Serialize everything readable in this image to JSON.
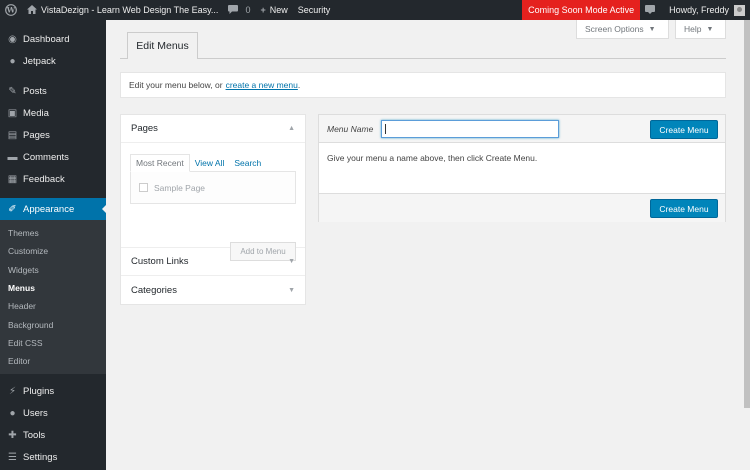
{
  "adminbar": {
    "site_name": "VistaDezign - Learn Web Design The Easy...",
    "comments_count": "0",
    "new_label": "New",
    "security_label": "Security",
    "coming_soon_label": "Coming Soon Mode Active",
    "howdy_label": "Howdy, Freddy"
  },
  "sidebar": {
    "items": [
      {
        "label": "Dashboard",
        "icon": "dashboard-icon"
      },
      {
        "label": "Jetpack",
        "icon": "jetpack-icon"
      },
      {
        "label": "Posts",
        "icon": "pin-icon"
      },
      {
        "label": "Media",
        "icon": "media-icon"
      },
      {
        "label": "Pages",
        "icon": "pages-icon"
      },
      {
        "label": "Comments",
        "icon": "comments-icon"
      },
      {
        "label": "Feedback",
        "icon": "feedback-icon"
      },
      {
        "label": "Appearance",
        "icon": "brush-icon"
      }
    ],
    "submenu": [
      "Themes",
      "Customize",
      "Widgets",
      "Menus",
      "Header",
      "Background",
      "Edit CSS",
      "Editor"
    ],
    "bottom_items": [
      {
        "label": "Plugins",
        "icon": "plug-icon"
      },
      {
        "label": "Users",
        "icon": "users-icon"
      },
      {
        "label": "Tools",
        "icon": "wrench-icon"
      },
      {
        "label": "Settings",
        "icon": "settings-icon"
      }
    ]
  },
  "screen_meta": {
    "screen_options": "Screen Options",
    "help": "Help"
  },
  "tabs": {
    "edit_menus": "Edit Menus"
  },
  "notice": {
    "text": "Edit your menu below, or",
    "link": "create a new menu",
    "end": "."
  },
  "accordion": {
    "pages_title": "Pages",
    "tabs": [
      "Most Recent",
      "View All",
      "Search"
    ],
    "sample_page": "Sample Page",
    "add_to_menu": "Add to Menu",
    "custom_links": "Custom Links",
    "categories": "Categories"
  },
  "menu_edit": {
    "name_label": "Menu Name",
    "name_value": "",
    "create_label": "Create Menu",
    "instruction": "Give your menu a name above, then click Create Menu."
  },
  "colors": {
    "admin_bg": "#23282d",
    "accent": "#0073aa",
    "button": "#0085ba",
    "coming_soon": "#e5211e"
  }
}
